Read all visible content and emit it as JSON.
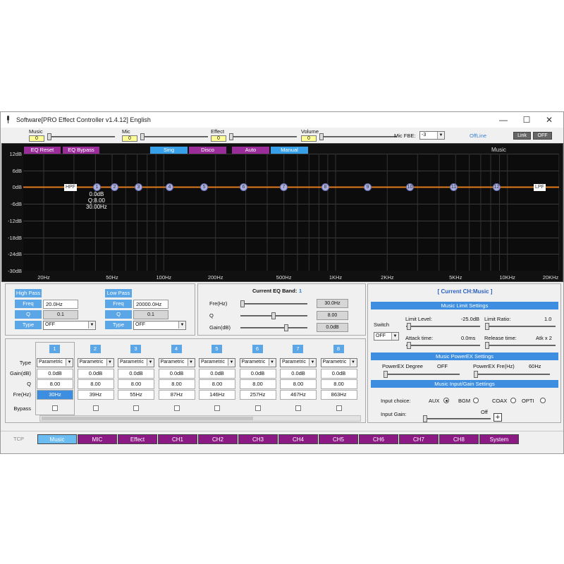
{
  "window": {
    "title": "Software[PRO Effect Controller v1.4.12] English",
    "controls": [
      "—",
      "☐",
      "✕"
    ]
  },
  "top": {
    "sliders": [
      {
        "label": "Music",
        "value": "0",
        "level": 0.0
      },
      {
        "label": "Mic",
        "value": "0",
        "level": 0.0
      },
      {
        "label": "Effect",
        "value": "0",
        "level": 0.0
      },
      {
        "label": "Volume",
        "value": "0",
        "level": 0.0
      }
    ],
    "mic_fbe_label": "Mic FBE:",
    "mic_fbe_value": "-3",
    "status": "OffLine",
    "link_label": "Link",
    "off_label": "OFF"
  },
  "eq": {
    "buttons": [
      "EQ Reset",
      "EQ Bypass",
      "Sing",
      "Disco",
      "Auto",
      "Manual"
    ],
    "channel": "Music",
    "y_ticks": [
      "12dB",
      "6dB",
      "0dB",
      "-6dB",
      "-12dB",
      "-18dB",
      "-24dB",
      "-30dB"
    ],
    "x_ticks": [
      "20Hz",
      "50Hz",
      "100Hz",
      "200Hz",
      "500Hz",
      "1KHz",
      "2KHz",
      "5KHz",
      "10KHz",
      "20KHz"
    ],
    "hpf_label": "HPF",
    "lpf_label": "LPF",
    "nodes": [
      "1",
      "2",
      "3",
      "4",
      "5",
      "6",
      "7",
      "8",
      "9",
      "10",
      "11",
      "12"
    ],
    "node_info": [
      "0.0dB",
      "Q:8.00",
      "30.00Hz"
    ]
  },
  "filters": {
    "high_pass": {
      "title": "High Pass",
      "freq_label": "Freq",
      "freq": "20.0Hz",
      "q_label": "Q",
      "q": "0.1",
      "type_label": "Type",
      "type": "OFF"
    },
    "low_pass": {
      "title": "Low Pass",
      "freq_label": "Freq",
      "freq": "20000.0Hz",
      "q_label": "Q",
      "q": "0.1",
      "type_label": "Type",
      "type": "OFF"
    }
  },
  "current_band": {
    "title": "Current EQ Band:",
    "band": "1",
    "rows": [
      {
        "label": "Fre(Hz)",
        "value": "30.0Hz",
        "level": 0.0
      },
      {
        "label": "Q",
        "value": "8.00",
        "level": 0.5
      },
      {
        "label": "Gain(dB)",
        "value": "0.0dB",
        "level": 0.7
      }
    ]
  },
  "bands": {
    "row_labels": [
      "Type",
      "Gain(dB)",
      "Q",
      "Fre(Hz)",
      "Bypass"
    ],
    "items": [
      {
        "num": "1",
        "type": "Parametric",
        "gain": "0.0dB",
        "q": "8.00",
        "freq": "30Hz"
      },
      {
        "num": "2",
        "type": "Parametric",
        "gain": "0.0dB",
        "q": "8.00",
        "freq": "39Hz"
      },
      {
        "num": "3",
        "type": "Parametric",
        "gain": "0.0dB",
        "q": "8.00",
        "freq": "55Hz"
      },
      {
        "num": "4",
        "type": "Parametric",
        "gain": "0.0dB",
        "q": "8.00",
        "freq": "87Hz"
      },
      {
        "num": "5",
        "type": "Parametric",
        "gain": "0.0dB",
        "q": "8.00",
        "freq": "146Hz"
      },
      {
        "num": "6",
        "type": "Parametric",
        "gain": "0.0dB",
        "q": "8.00",
        "freq": "257Hz"
      },
      {
        "num": "7",
        "type": "Parametric",
        "gain": "0.0dB",
        "q": "8.00",
        "freq": "467Hz"
      },
      {
        "num": "8",
        "type": "Parametric",
        "gain": "0.0dB",
        "q": "8.00",
        "freq": "863Hz"
      }
    ]
  },
  "right": {
    "title": "[ Current CH:Music ]",
    "limit_hdr": "Music Limit Settings",
    "switch_label": "Switch",
    "switch_value": "OFF",
    "limit_level_label": "Limit Level:",
    "limit_level": "-25.0dB",
    "limit_ratio_label": "Limit Ratio:",
    "limit_ratio": "1.0",
    "attack_label": "Attack time:",
    "attack": "0.0ms",
    "release_label": "Release time:",
    "release": "Atk x 2",
    "powerex_hdr": "Music PowerEX Settings",
    "powerex_degree_label": "PowerEX Degree",
    "powerex_degree": "OFF",
    "powerex_fre_label": "PowerEX Fre(Hz)",
    "powerex_fre": "60Hz",
    "input_hdr": "Music Input/Gain Settings",
    "input_choice_label": "Input choice:",
    "inputs": [
      "AUX",
      "BGM",
      "COAX",
      "OPTI"
    ],
    "selected_input": "AUX",
    "input_gain_label": "Input Gain:",
    "input_gain": "Off",
    "plus": "+"
  },
  "bottom": {
    "tcp_label": "TCP",
    "tabs": [
      "Music",
      "MIC",
      "Effect",
      "CH1",
      "CH2",
      "CH3",
      "CH4",
      "CH5",
      "CH6",
      "CH7",
      "CH8",
      "System"
    ],
    "selected": "Music"
  },
  "colors": {
    "eq_bg": "#0c0c0c",
    "eq_curve": "#e07a1e",
    "tab_purple": "#8c1a85",
    "accent_blue": "#37a0e8"
  }
}
